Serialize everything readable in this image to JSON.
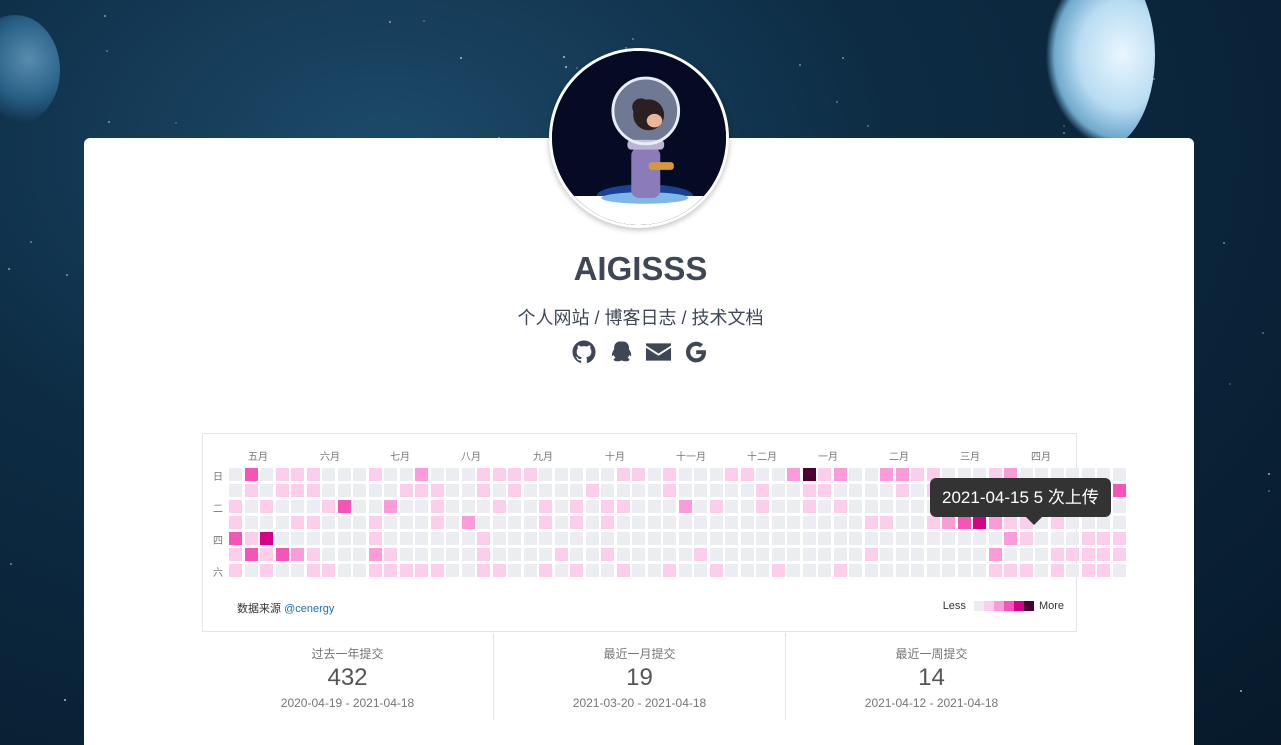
{
  "profile": {
    "name": "AIGISSS",
    "subtitle": "个人网站 / 博客日志 / 技术文档"
  },
  "social_icons": [
    "github-icon",
    "qq-icon",
    "mail-icon",
    "google-icon"
  ],
  "calendar": {
    "months": [
      "五月",
      "六月",
      "七月",
      "八月",
      "九月",
      "十月",
      "十一月",
      "十二月",
      "一月",
      "二月",
      "三月",
      "四月"
    ],
    "weekdays": [
      "日",
      "二",
      "四",
      "六"
    ],
    "source_label": "数据来源",
    "source_link": "@cenergy",
    "legend_less": "Less",
    "legend_more": "More",
    "colors": [
      "#ebedf0",
      "#fdcdec",
      "#fc9bd9",
      "#f455b8",
      "#d6008a",
      "#4d0032"
    ],
    "levels": [
      "0301110001002000111100000110100011002512002211000120000000",
      "0101110000011100101000010000100000100110000101113000122203",
      "1010001300200100010010101100020100100101000000002311112100",
      "1000110001000102000010101000000000000000011001234211010000",
      "3140000001000000100000000000000000000000000000000021000111",
      "1313210002100000100001001000001000000000010000000200011111",
      "1010011001111100110010100100100100010001000000000111010110"
    ],
    "tooltip": "2021-04-15 5 次上传"
  },
  "stats": [
    {
      "label": "过去一年提交",
      "value": "432",
      "range": "2020-04-19 - 2021-04-18"
    },
    {
      "label": "最近一月提交",
      "value": "19",
      "range": "2021-03-20 - 2021-04-18"
    },
    {
      "label": "最近一周提交",
      "value": "14",
      "range": "2021-04-12 - 2021-04-18"
    }
  ]
}
